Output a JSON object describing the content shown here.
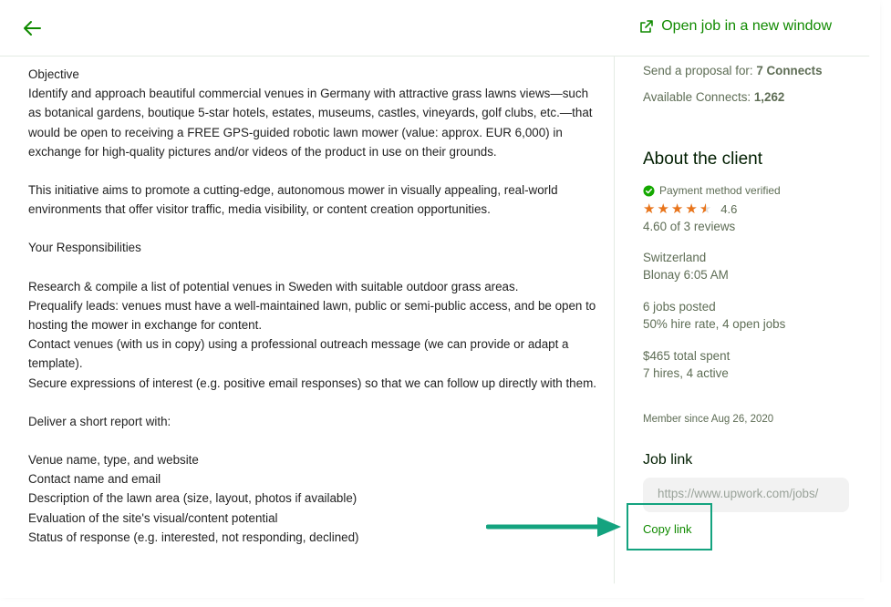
{
  "header": {
    "open_new_window": "Open job in a new window"
  },
  "description": {
    "paragraphs": [
      "Objective\nIdentify and approach beautiful commercial venues in Germany with attractive grass lawns views—such as botanical gardens, boutique 5-star hotels, estates, museums, castles, vineyards, golf clubs, etc.—that would be open to receiving a FREE GPS-guided robotic lawn mower (value: approx. EUR 6,000) in exchange for high-quality pictures and/or videos of the product in use on their grounds.",
      "This initiative aims to promote a cutting-edge, autonomous mower in visually appealing, real-world environments that offer visitor traffic, media visibility, or content creation opportunities.",
      "Your Responsibilities",
      "Research & compile a list of potential venues in Sweden with suitable outdoor grass areas.\nPrequalify leads: venues must have a well-maintained lawn, public or semi-public access, and be open to hosting the mower in exchange for content.\nContact venues (with us in copy) using a professional outreach message (we can provide or adapt a template).\nSecure expressions of interest (e.g. positive email responses) so that we can follow up directly with them.",
      "Deliver a short report with:",
      "Venue name, type, and website\nContact name and email\nDescription of the lawn area (size, layout, photos if available)\nEvaluation of the site's visual/content potential\nStatus of response (e.g. interested, not responding, declined)"
    ]
  },
  "sidebar": {
    "proposal_label": "Send a proposal for:",
    "proposal_value": "7 Connects",
    "available_label": "Available Connects:",
    "available_value": "1,262",
    "about_title": "About the client",
    "payment_verified": "Payment method verified",
    "rating_value": "4.6",
    "rating_stars": 4.6,
    "reviews": "4.60 of 3 reviews",
    "country": "Switzerland",
    "city_time": "Blonay 6:05 AM",
    "jobs_posted": "6 jobs posted",
    "hire_rate": "50% hire rate, 4 open jobs",
    "total_spent": "$465 total spent",
    "hires": "7 hires, 4 active",
    "member_since": "Member since Aug 26, 2020",
    "job_link_title": "Job link",
    "job_link_value": "https://www.upwork.com/jobs/",
    "copy_link": "Copy link"
  },
  "colors": {
    "accent": "#108a00",
    "annotation": "#14a37f",
    "star": "#e8741a"
  }
}
